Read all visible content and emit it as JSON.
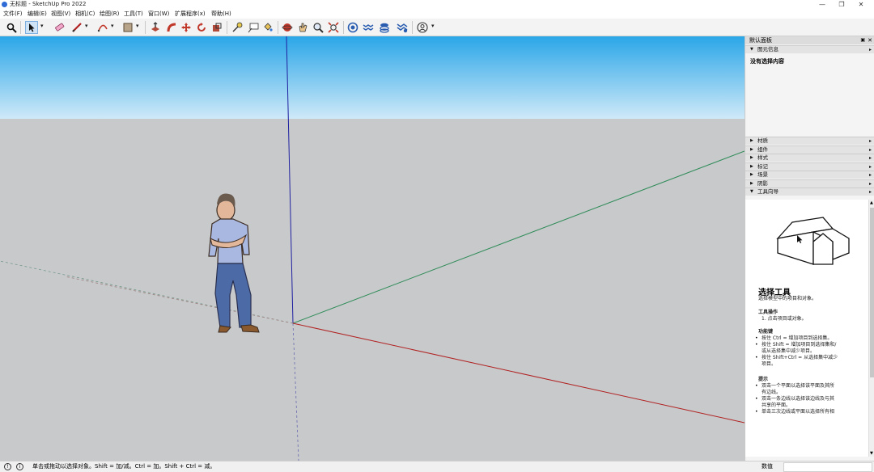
{
  "window": {
    "title": "无标题 - SketchUp Pro 2022",
    "min": "—",
    "max": "❐",
    "close": "✕"
  },
  "menu": [
    "文件(F)",
    "编辑(E)",
    "视图(V)",
    "相机(C)",
    "绘图(R)",
    "工具(T)",
    "窗口(W)",
    "扩展程序(x)",
    "帮助(H)"
  ],
  "toolbar": {
    "dropdown": "▾"
  },
  "panel": {
    "title": "默认面板",
    "pin": "▣",
    "close": "✕",
    "entity_info": {
      "label": "图元信息",
      "value": "没有选择内容"
    },
    "sections": [
      "材质",
      "组件",
      "样式",
      "标记",
      "场景",
      "阴影",
      "工具向导"
    ],
    "instructor": {
      "heading": "选择工具",
      "subtitle": "选择模型中的项目和对象。",
      "ops_title": "工具操作",
      "ops": [
        "1. 点击项目或对象。"
      ],
      "keys_title": "功能键",
      "keys": [
        "按住 Ctrl = 增加项目到选择集。",
        "按住 Shift = 增加项目到选择集和/",
        "或从选择集中减少项目。",
        "按住 Shift+Ctrl = 从选择集中减少",
        "项目。"
      ],
      "tips_title": "提示",
      "tips": [
        "双击一个平面以选择该平面及其所",
        "有边线。",
        "双击一条边线以选择该边线及与其",
        "共享的平面。",
        "单击三次边线或平面以选择所有相"
      ]
    }
  },
  "status": {
    "message": "单击或拖动以选择对象。Shift = 加/减。Ctrl = 加。Shift + Ctrl = 减。",
    "value_label": "数值",
    "value": ""
  }
}
